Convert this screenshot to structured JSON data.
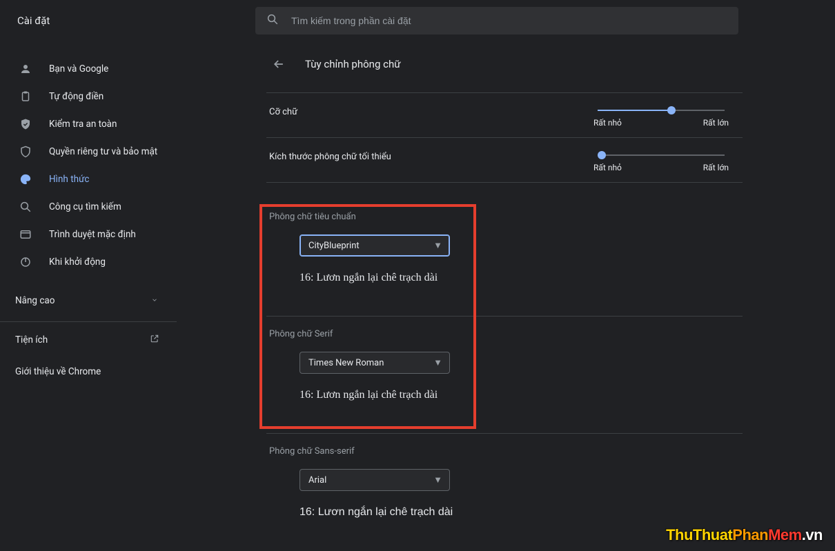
{
  "app": {
    "title": "Cài đặt"
  },
  "search": {
    "placeholder": "Tìm kiếm trong phần cài đặt"
  },
  "sidebar": {
    "items": [
      {
        "label": "Bạn và Google",
        "icon": "person-icon"
      },
      {
        "label": "Tự động điền",
        "icon": "clipboard-icon"
      },
      {
        "label": "Kiểm tra an toàn",
        "icon": "check-shield-icon"
      },
      {
        "label": "Quyền riêng tư và bảo mật",
        "icon": "shield-icon"
      },
      {
        "label": "Hình thức",
        "icon": "palette-icon"
      },
      {
        "label": "Công cụ tìm kiếm",
        "icon": "magnifier-icon"
      },
      {
        "label": "Trình duyệt mặc định",
        "icon": "browser-icon"
      },
      {
        "label": "Khi khởi động",
        "icon": "power-icon"
      }
    ],
    "advanced": "Nâng cao",
    "extensions": "Tiện ích",
    "about": "Giới thiệu về Chrome"
  },
  "page": {
    "title": "Tùy chỉnh phông chữ",
    "font_size": {
      "label": "Cỡ chữ",
      "min": "Rất nhỏ",
      "max": "Rất lớn",
      "value_pct": 58
    },
    "min_font_size": {
      "label": "Kích thước phông chữ tối thiểu",
      "min": "Rất nhỏ",
      "max": "Rất lớn",
      "value_pct": 3
    },
    "standard_font": {
      "label": "Phông chữ tiêu chuẩn",
      "value": "CityBlueprint",
      "sample": "16: Lươn ngắn lại chê trạch dài"
    },
    "serif_font": {
      "label": "Phông chữ Serif",
      "value": "Times New Roman",
      "sample": "16: Lươn ngắn lại chê trạch dài"
    },
    "sans_font": {
      "label": "Phông chữ Sans-serif",
      "value": "Arial",
      "sample": "16: Lươn ngắn lại chê trạch dài"
    }
  },
  "watermark": {
    "p1": "ThuThuat",
    "p2": "Phan",
    "p3": "Mem",
    "p4": ".vn"
  }
}
